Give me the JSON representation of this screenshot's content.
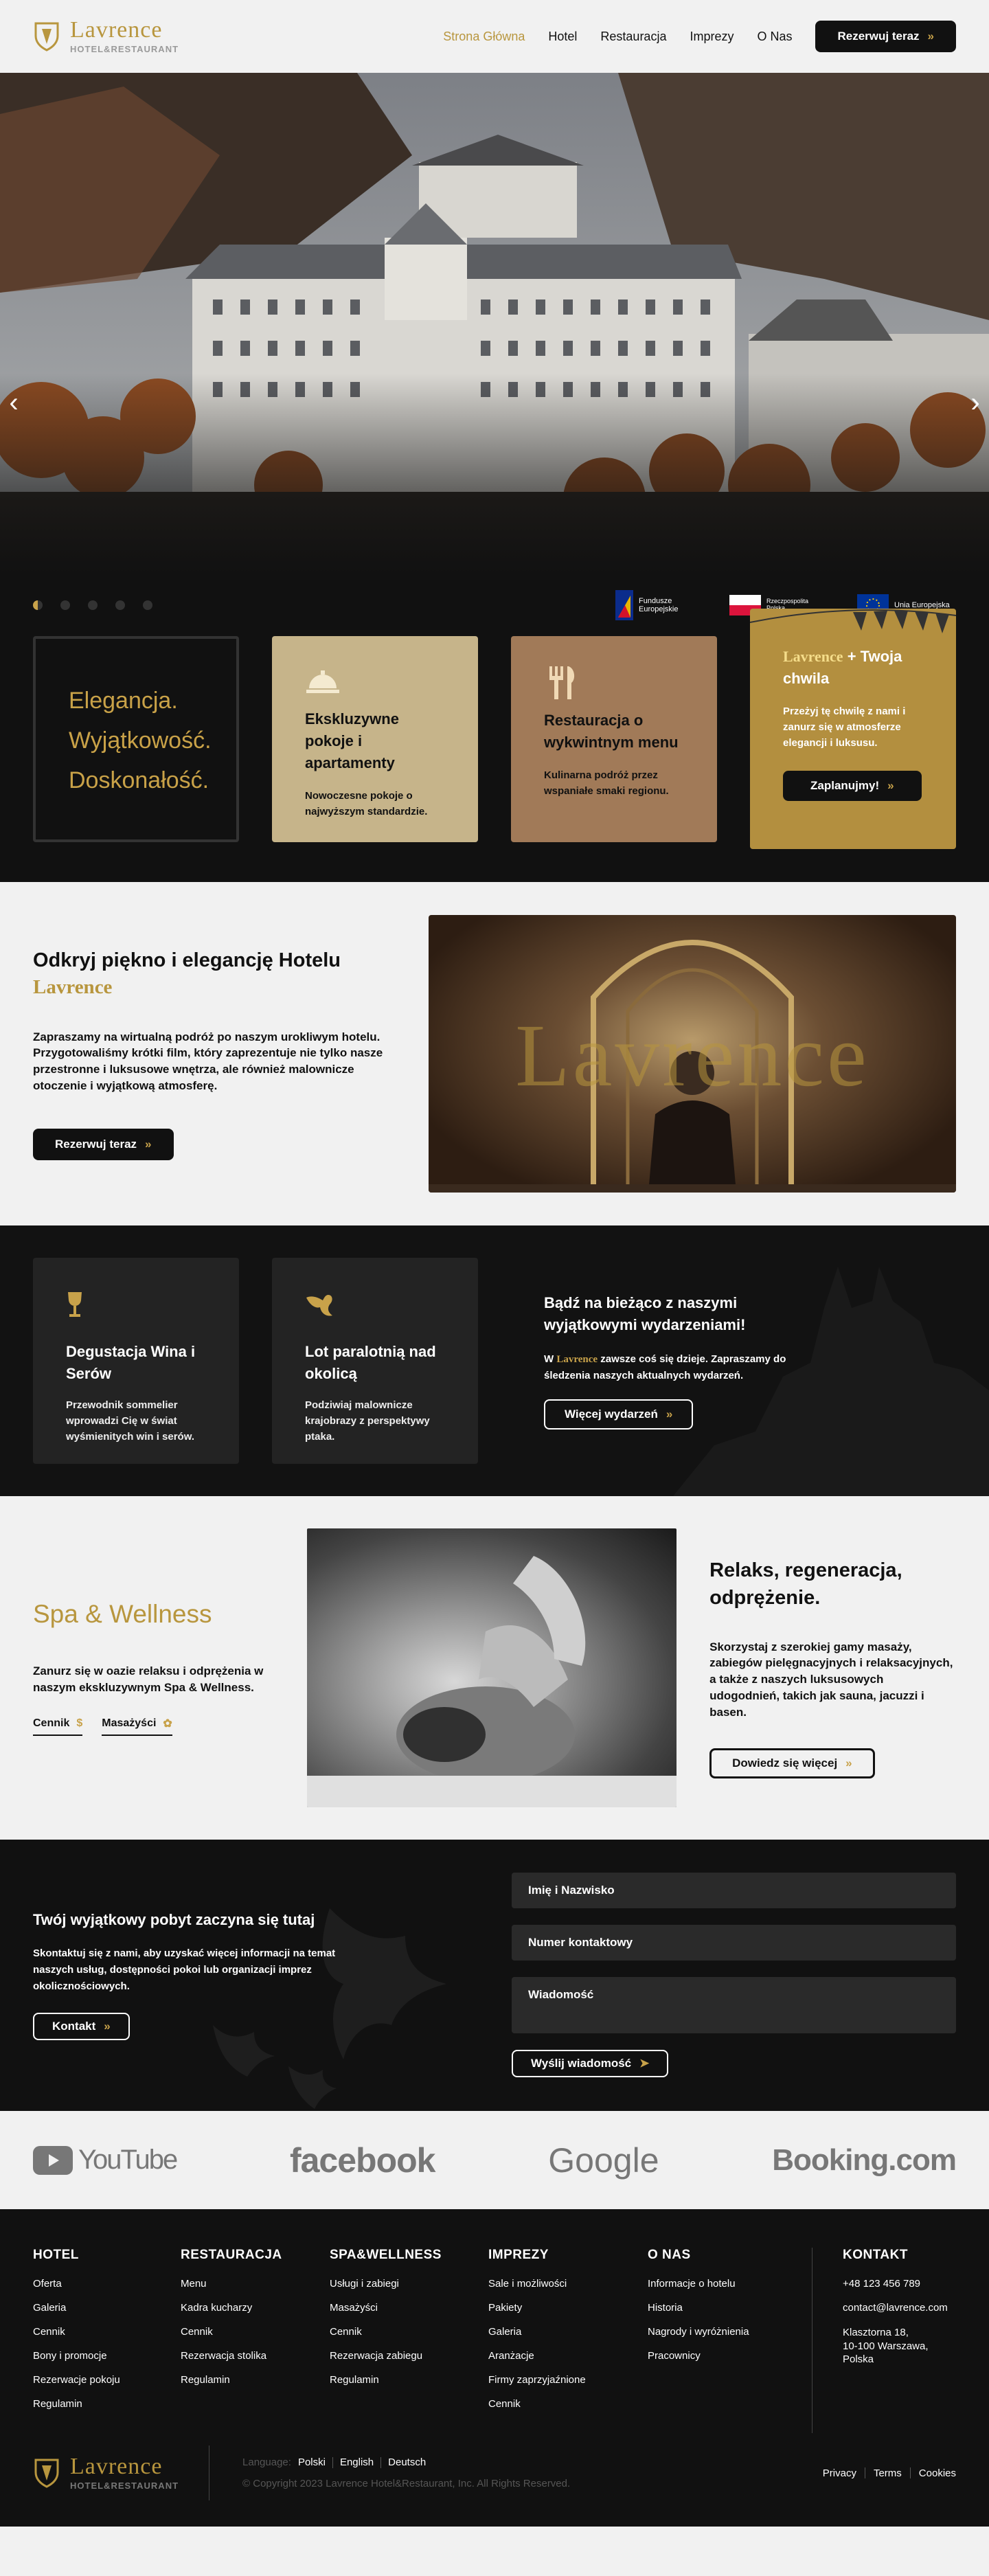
{
  "header": {
    "brand": "Lavrence",
    "brand_sub": "HOTEL&RESTAURANT",
    "nav": [
      "Strona Główna",
      "Hotel",
      "Restauracja",
      "Imprezy",
      "O Nas"
    ],
    "cta": "Rezerwuj teraz",
    "accent": "#b8963e"
  },
  "hero": {
    "slide_count": 5,
    "active_slide": 1
  },
  "funds": {
    "fe": "Fundusze Europejskie",
    "rp": "Rzeczpospolita Polska",
    "ue": "Unia Europejska"
  },
  "cards": {
    "motto": [
      "Elegancja.",
      "Wyjątkowość.",
      "Doskonałość."
    ],
    "rooms_title": "Ekskluzywne pokoje i apartamenty",
    "rooms_text": "Nowoczesne pokoje o najwyższym standardzie.",
    "rest_title": "Restauracja o wykwintnym menu",
    "rest_text": "Kulinarna podróż przez wspaniałe smaki regionu.",
    "promo_brand": "Lavrence",
    "promo_title": "+ Twoja chwila",
    "promo_text": "Przeżyj tę chwilę z nami i zanurz się w atmosferze elegancji i luksusu.",
    "promo_cta": "Zaplanujmy!"
  },
  "discover": {
    "title": "Odkryj piękno i elegancję Hotelu",
    "brand": "Lavrence",
    "text": "Zapraszamy na wirtualną podróż po naszym urokliwym hotelu. Przygotowaliśmy krótki film, który zaprezentuje nie tylko nasze przestronne i luksusowe wnętrza, ale również malownicze otoczenie i wyjątkową atmosferę.",
    "cta": "Rezerwuj teraz",
    "video_brand": "Lavrence"
  },
  "events": {
    "wine_title": "Degustacja Wina i Serów",
    "wine_text": "Przewodnik sommelier wprowadzi Cię w świat wyśmienitych win i serów.",
    "flight_title": "Lot paralotnią nad okolicą",
    "flight_text": "Podziwiaj malownicze krajobrazy z perspektywy ptaka.",
    "news_title": "Bądź na bieżąco z naszymi wyjątkowymi wydarzeniami!",
    "news_pre": "W",
    "news_brand": "Lavrence",
    "news_post": "zawsze coś się dzieje. Zapraszamy do śledzenia naszych aktualnych wydarzeń.",
    "cta": "Więcej wydarzeń"
  },
  "spa": {
    "title": "Spa & Wellness",
    "text": "Zanurz się w oazie relaksu i odprężenia w naszym ekskluzywnym Spa & Wellness.",
    "tab1": "Cennik",
    "tab2": "Masażyści",
    "right_title": "Relaks, regeneracja, odprężenie.",
    "right_text": "Skorzystaj z szerokiej gamy masaży, zabiegów pielęgnacyjnych i relaksacyjnych, a także z naszych luksusowych udogodnień, takich jak sauna, jacuzzi i basen.",
    "cta": "Dowiedz się więcej"
  },
  "contact": {
    "title": "Twój wyjątkowy pobyt zaczyna się tutaj",
    "text": "Skontaktuj się z nami, aby uzyskać więcej informacji na temat naszych usług, dostępności pokoi lub organizacji imprez okolicznościowych.",
    "cta": "Kontakt",
    "name_ph": "Imię i Nazwisko",
    "phone_ph": "Numer kontaktowy",
    "msg_ph": "Wiadomość",
    "send": "Wyślij wiadomość"
  },
  "social": {
    "youtube": "YouTube",
    "facebook": "facebook",
    "google": "Google",
    "booking": "Booking.com"
  },
  "footer": {
    "hotel_h": "HOTEL",
    "hotel": [
      "Oferta",
      "Galeria",
      "Cennik",
      "Bony i promocje",
      "Rezerwacje pokoju",
      "Regulamin"
    ],
    "rest_h": "RESTAURACJA",
    "rest": [
      "Menu",
      "Kadra kucharzy",
      "Cennik",
      "Rezerwacja stolika",
      "Regulamin"
    ],
    "spa_h": "SPA&WELLNESS",
    "spa": [
      "Usługi i zabiegi",
      "Masażyści",
      "Cennik",
      "Rezerwacja zabiegu",
      "Regulamin"
    ],
    "imp_h": "IMPREZY",
    "imp": [
      "Sale i możliwości",
      "Pakiety",
      "Galeria",
      "Aranżacje",
      "Firmy zaprzyjaźnione",
      "Cennik"
    ],
    "about_h": "O NAS",
    "about": [
      "Informacje o hotelu",
      "Historia",
      "Nagrody i wyróżnienia",
      "Pracownicy"
    ],
    "contact_h": "KONTAKT",
    "phone": "+48 123 456 789",
    "email": "contact@lavrence.com",
    "address": "Klasztorna 18,\n10-100 Warszawa,\nPolska",
    "lang_label": "Language:",
    "langs": [
      "Polski",
      "English",
      "Deutsch"
    ],
    "copyright": "© Copyright 2023 Lavrence Hotel&Restaurant, Inc. All Rights Reserved.",
    "legal": [
      "Privacy",
      "Terms",
      "Cookies"
    ]
  }
}
